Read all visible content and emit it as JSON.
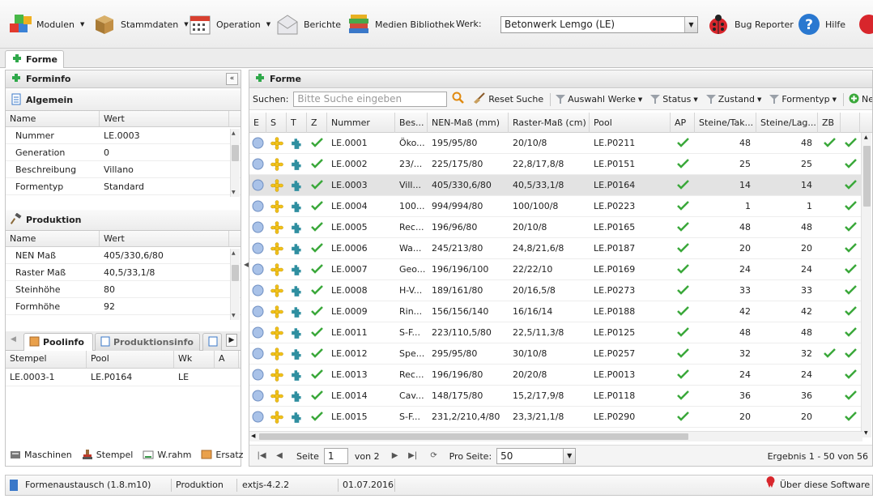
{
  "toolbar": {
    "modulen": "Modulen",
    "stammdaten": "Stammdaten",
    "operation": "Operation",
    "berichte": "Berichte",
    "medien": "Medien Bibliothek",
    "werk_label": "Werk:",
    "werk_value": "Betonwerk Lemgo (LE)",
    "bug": "Bug Reporter",
    "hilfe": "Hilfe"
  },
  "main_tab": "Forme",
  "forminfo": {
    "title": "Forminfo",
    "allgemein": {
      "title": "Algemein",
      "col_name": "Name",
      "col_wert": "Wert",
      "rows": [
        {
          "name": "Nummer",
          "wert": "LE.0003"
        },
        {
          "name": "Generation",
          "wert": "0"
        },
        {
          "name": "Beschreibung",
          "wert": "Villano"
        },
        {
          "name": "Formentyp",
          "wert": "Standard"
        }
      ]
    },
    "produktion": {
      "title": "Produktion",
      "col_name": "Name",
      "col_wert": "Wert",
      "rows": [
        {
          "name": "NEN Maß",
          "wert": "405/330,6/80"
        },
        {
          "name": "Raster Maß",
          "wert": "40,5/33,1/8"
        },
        {
          "name": "Steinhöhe",
          "wert": "80"
        },
        {
          "name": "Formhöhe",
          "wert": "92"
        }
      ]
    },
    "subtabs": [
      "Poolinfo",
      "Produktionsinfo"
    ],
    "pool": {
      "cols": [
        "Stempel",
        "Pool",
        "Wk",
        "A"
      ],
      "rows": [
        {
          "stempel": "LE.0003-1",
          "pool": "LE.P0164",
          "wk": "LE",
          "a": ""
        }
      ]
    },
    "bottom": [
      "Maschinen",
      "Stempel",
      "W.rahm",
      "Ersatz"
    ]
  },
  "forme": {
    "title": "Forme",
    "search_label": "Suchen:",
    "search_placeholder": "Bitte Suche eingeben",
    "reset": "Reset Suche",
    "filters": [
      "Auswahl Werke",
      "Status",
      "Zustand",
      "Formentyp"
    ],
    "new_label": "Ne",
    "columns": [
      "E",
      "S",
      "T",
      "Z",
      "Nummer",
      "Bes...",
      "NEN-Maß (mm)",
      "Raster-Maß (cm)",
      "Pool",
      "AP",
      "Steine/Tak...",
      "Steine/Lag...",
      "ZB",
      "",
      ""
    ],
    "rows": [
      {
        "nr": "LE.0001",
        "bes": "Öko...",
        "nen": "195/95/80",
        "raster": "20/10/8",
        "pool": "LE.P0211",
        "st": "48",
        "sl": "48",
        "zb": true,
        "sel": false
      },
      {
        "nr": "LE.0002",
        "bes": "23/...",
        "nen": "225/175/80",
        "raster": "22,8/17,8/8",
        "pool": "LE.P0151",
        "st": "25",
        "sl": "25",
        "zb": false,
        "sel": false
      },
      {
        "nr": "LE.0003",
        "bes": "Vill...",
        "nen": "405/330,6/80",
        "raster": "40,5/33,1/8",
        "pool": "LE.P0164",
        "st": "14",
        "sl": "14",
        "zb": false,
        "sel": true
      },
      {
        "nr": "LE.0004",
        "bes": "100...",
        "nen": "994/994/80",
        "raster": "100/100/8",
        "pool": "LE.P0223",
        "st": "1",
        "sl": "1",
        "zb": false,
        "sel": false
      },
      {
        "nr": "LE.0005",
        "bes": "Rec...",
        "nen": "196/96/80",
        "raster": "20/10/8",
        "pool": "LE.P0165",
        "st": "48",
        "sl": "48",
        "zb": false,
        "sel": false
      },
      {
        "nr": "LE.0006",
        "bes": "Wa...",
        "nen": "245/213/80",
        "raster": "24,8/21,6/8",
        "pool": "LE.P0187",
        "st": "20",
        "sl": "20",
        "zb": false,
        "sel": false
      },
      {
        "nr": "LE.0007",
        "bes": "Geo...",
        "nen": "196/196/100",
        "raster": "22/22/10",
        "pool": "LE.P0169",
        "st": "24",
        "sl": "24",
        "zb": false,
        "sel": false
      },
      {
        "nr": "LE.0008",
        "bes": "H-V...",
        "nen": "189/161/80",
        "raster": "20/16,5/8",
        "pool": "LE.P0273",
        "st": "33",
        "sl": "33",
        "zb": false,
        "sel": false
      },
      {
        "nr": "LE.0009",
        "bes": "Rin...",
        "nen": "156/156/140",
        "raster": "16/16/14",
        "pool": "LE.P0188",
        "st": "42",
        "sl": "42",
        "zb": false,
        "sel": false
      },
      {
        "nr": "LE.0011",
        "bes": "S-F...",
        "nen": "223/110,5/80",
        "raster": "22,5/11,3/8",
        "pool": "LE.P0125",
        "st": "48",
        "sl": "48",
        "zb": false,
        "sel": false
      },
      {
        "nr": "LE.0012",
        "bes": "Spe...",
        "nen": "295/95/80",
        "raster": "30/10/8",
        "pool": "LE.P0257",
        "st": "32",
        "sl": "32",
        "zb": true,
        "sel": false
      },
      {
        "nr": "LE.0013",
        "bes": "Rec...",
        "nen": "196/196/80",
        "raster": "20/20/8",
        "pool": "LE.P0013",
        "st": "24",
        "sl": "24",
        "zb": false,
        "sel": false
      },
      {
        "nr": "LE.0014",
        "bes": "Cav...",
        "nen": "148/175/80",
        "raster": "15,2/17,9/8",
        "pool": "LE.P0118",
        "st": "36",
        "sl": "36",
        "zb": false,
        "sel": false
      },
      {
        "nr": "LE.0015",
        "bes": "S-F...",
        "nen": "231,2/210,4/80",
        "raster": "23,3/21,1/8",
        "pool": "LE.P0290",
        "st": "20",
        "sl": "20",
        "zb": false,
        "sel": false
      }
    ],
    "pager": {
      "seite": "Seite",
      "page": "1",
      "von": "von 2",
      "pro_seite": "Pro Seite:",
      "per_page": "50",
      "ergebnis": "Ergebnis 1 - 50 von 56"
    }
  },
  "statusbar": {
    "app": "Formenaustausch (1.8.m10)",
    "mode": "Produktion",
    "lib": "extjs-4.2.2",
    "date": "01.07.2016",
    "about": "Über diese Software"
  },
  "colors": {
    "check": "#3aa83a",
    "puzzle": "#2f8fa0",
    "star": "#f2c218",
    "circle": "#9fb8e0"
  }
}
